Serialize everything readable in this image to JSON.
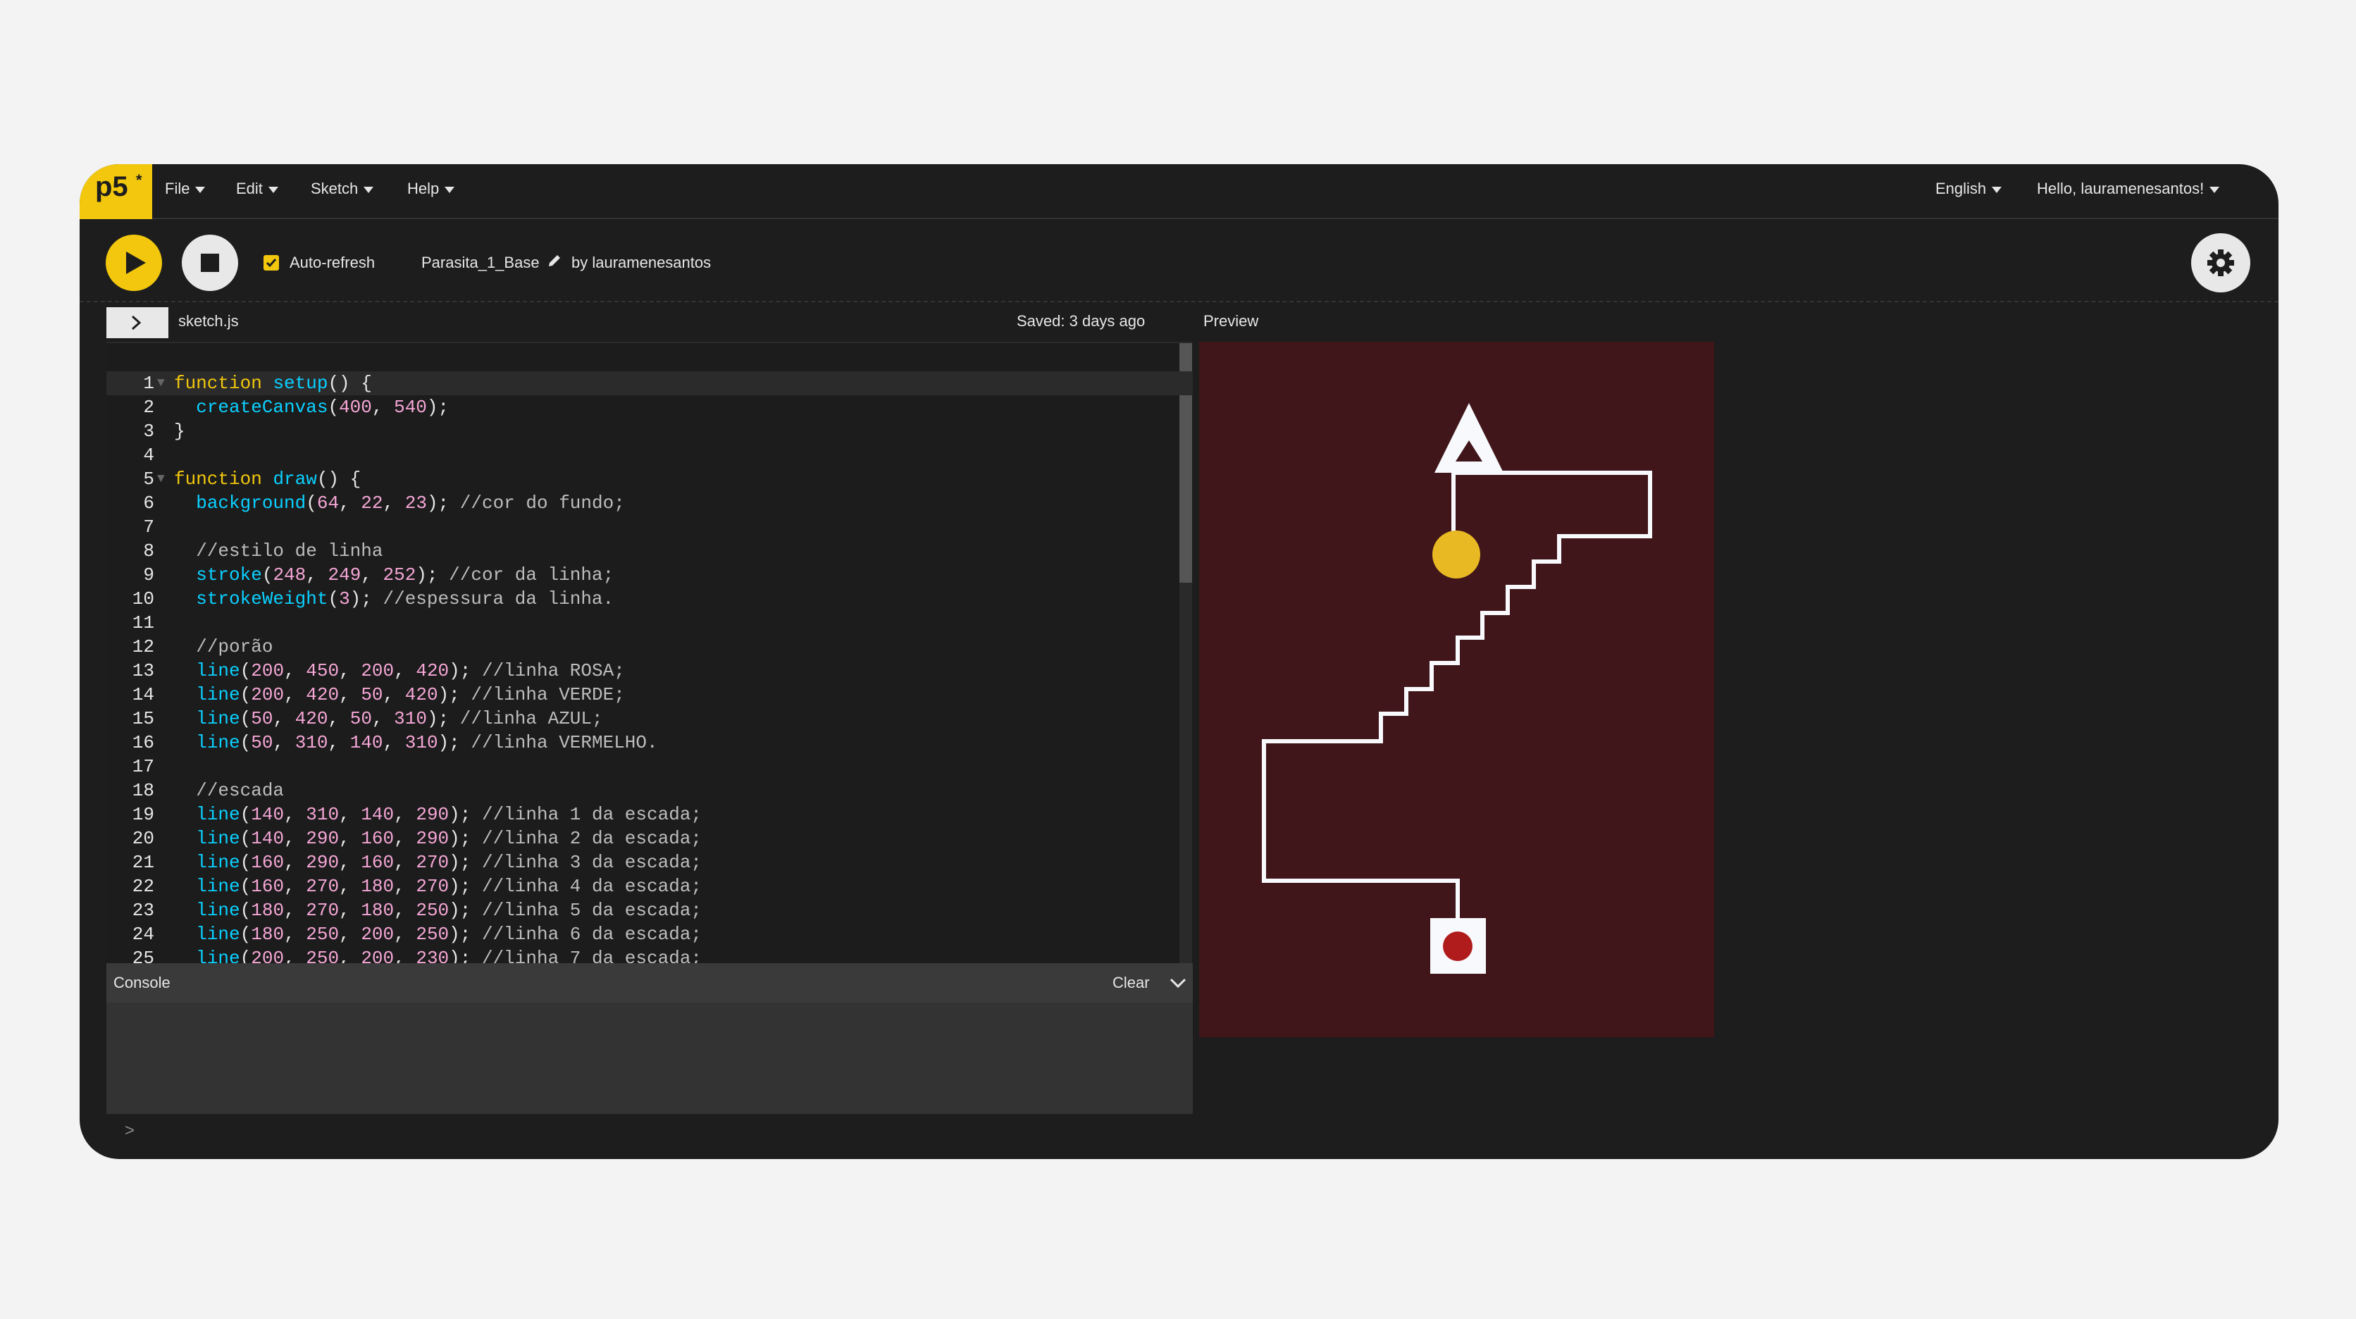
{
  "menubar": {
    "logo": "p5",
    "file": "File",
    "edit": "Edit",
    "sketch": "Sketch",
    "help": "Help",
    "language": "English",
    "user": "Hello, lauramenesantos!"
  },
  "toolbar": {
    "auto_refresh": "Auto-refresh",
    "auto_refresh_checked": true,
    "sketch_name": "Parasita_1_Base",
    "author": "by lauramenesantos"
  },
  "editor": {
    "filename": "sketch.js",
    "saved": "Saved: 3 days ago",
    "lines": [
      {
        "n": "1",
        "text": "function setup() {"
      },
      {
        "n": "2",
        "text": "  createCanvas(400, 540);"
      },
      {
        "n": "3",
        "text": "}"
      },
      {
        "n": "4",
        "text": ""
      },
      {
        "n": "5",
        "text": "function draw() {"
      },
      {
        "n": "6",
        "text": "  background(64, 22, 23); //cor do fundo;"
      },
      {
        "n": "7",
        "text": ""
      },
      {
        "n": "8",
        "text": "  //estilo de linha"
      },
      {
        "n": "9",
        "text": "  stroke(248, 249, 252); //cor da linha;"
      },
      {
        "n": "10",
        "text": "  strokeWeight(3); //espessura da linha."
      },
      {
        "n": "11",
        "text": ""
      },
      {
        "n": "12",
        "text": "  //porão"
      },
      {
        "n": "13",
        "text": "  line(200, 450, 200, 420); //linha ROSA;"
      },
      {
        "n": "14",
        "text": "  line(200, 420, 50, 420); //linha VERDE;"
      },
      {
        "n": "15",
        "text": "  line(50, 420, 50, 310); //linha AZUL;"
      },
      {
        "n": "16",
        "text": "  line(50, 310, 140, 310); //linha VERMELHO."
      },
      {
        "n": "17",
        "text": ""
      },
      {
        "n": "18",
        "text": "  //escada"
      },
      {
        "n": "19",
        "text": "  line(140, 310, 140, 290); //linha 1 da escada;"
      },
      {
        "n": "20",
        "text": "  line(140, 290, 160, 290); //linha 2 da escada;"
      },
      {
        "n": "21",
        "text": "  line(160, 290, 160, 270); //linha 3 da escada;"
      },
      {
        "n": "22",
        "text": "  line(160, 270, 180, 270); //linha 4 da escada;"
      },
      {
        "n": "23",
        "text": "  line(180, 270, 180, 250); //linha 5 da escada;"
      },
      {
        "n": "24",
        "text": "  line(180, 250, 200, 250); //linha 6 da escada;"
      },
      {
        "n": "25",
        "text": "  line(200, 250, 200, 230); //linha 7 da escada;"
      }
    ]
  },
  "console": {
    "title": "Console",
    "clear": "Clear",
    "prompt": ">"
  },
  "preview": {
    "label": "Preview",
    "background_color": "#40161a",
    "line_color": "#f8f9fc",
    "circle_yellow": "#e8b923",
    "circle_red": "#b01c1c"
  },
  "colors": {
    "accent": "#f2c70d",
    "keyword": "#f2c70d",
    "function": "#0bd0ff",
    "number": "#f5a6d6"
  }
}
